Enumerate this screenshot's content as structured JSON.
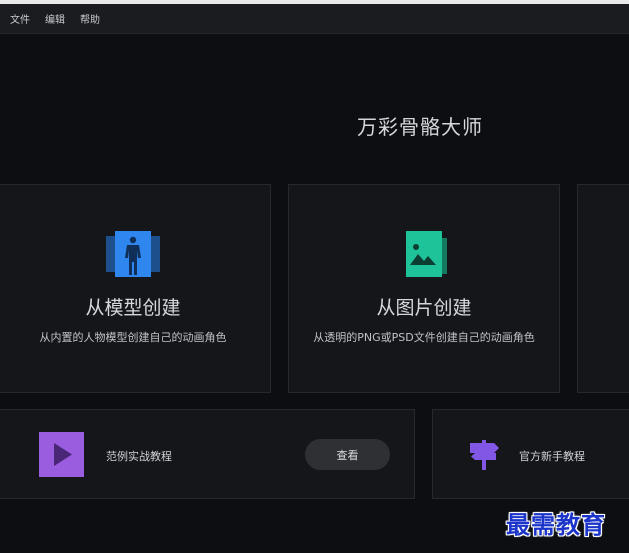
{
  "menu": {
    "items": [
      "文件",
      "编辑",
      "帮助"
    ]
  },
  "app": {
    "title": "万彩骨骼大师"
  },
  "cards": [
    {
      "title": "从模型创建",
      "subtitle": "从内置的人物模型创建自己的动画角色",
      "icon": "human-figure-icon",
      "icon_color": "#2f86ef"
    },
    {
      "title": "从图片创建",
      "subtitle": "从透明的PNG或PSD文件创建自己的动画角色",
      "icon": "image-icon",
      "icon_color": "#1fc39a"
    }
  ],
  "tutorials": {
    "examples_label": "范例实战教程",
    "examples_icon": "play-icon",
    "examples_icon_color": "#9b5de0",
    "view_button": "查看",
    "beginner_label": "官方新手教程",
    "beginner_icon": "signpost-icon",
    "beginner_icon_color": "#8257e6"
  },
  "watermark": "最需教育"
}
